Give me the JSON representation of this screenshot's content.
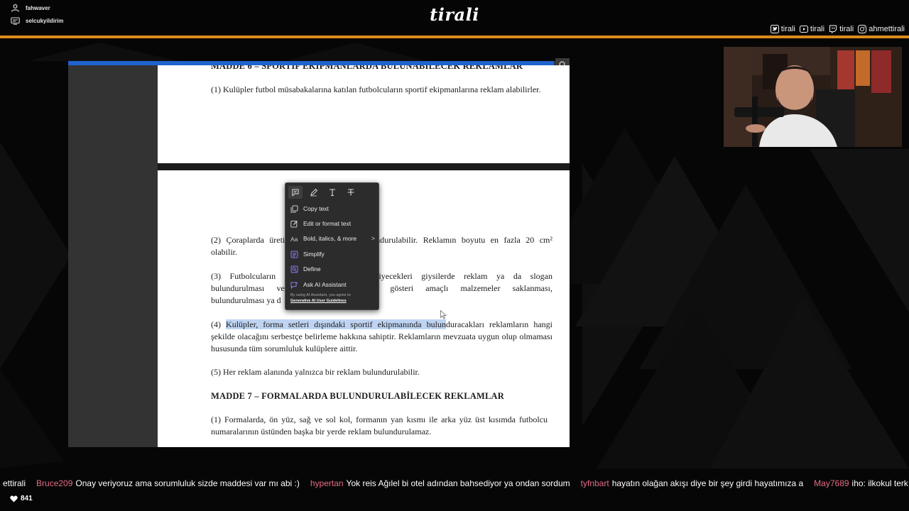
{
  "overlay": {
    "top_users": [
      {
        "icon": "user-icon",
        "name": "fahwaver"
      },
      {
        "icon": "subscriber-icon",
        "name": "selcukyildirim"
      }
    ],
    "logo": "tirali",
    "socials": [
      {
        "icon": "twitter-icon",
        "handle": "tirali"
      },
      {
        "icon": "youtube-icon",
        "handle": "tirali"
      },
      {
        "icon": "twitch-icon",
        "handle": "tirali"
      },
      {
        "icon": "instagram-icon",
        "handle": "ahmettirali"
      }
    ],
    "accent_color": "#d98c1c"
  },
  "document": {
    "page1": {
      "heading_cut": "MADDE 6 – SPORTİF EKİPMANLARDA BULUNABİLECEK REKLAMLAR",
      "para1": "(1) Kulüpler futbol müsabakalarına katılan futbolcuların sportif ekipmanlarına reklam alabilirler."
    },
    "page2": {
      "para2_a": "(2) Çoraplarda üreti",
      "para2_b": "undurulabilir. Reklamın boyutu en fazla 20 cm² olabilir.",
      "para3_a": "(3) Futbolcuların s",
      "para3_b": "giyecekleri giysilerde reklam ya da slogan bulundurulması ve",
      "para3_c": "da gösteri amaçlı malzemeler saklanması, bulundurulması ya d",
      "para4_selected": "Kulüpler, forma setleri dışındaki sportif ekipmanında bulun",
      "para4_prefix": "(4) ",
      "para4_rest": "duracakları reklamların hangi şekilde olacağını serbestçe belirleme hakkına sahiptir. Reklamların mevzuata uygun olup olmaması hususunda tüm sorumluluk kulüplere aittir.",
      "para5": "(5) Her reklam alanında yalnızca bir reklam bulundurulabilir.",
      "heading7": "MADDE 7 – FORMALARDA BULUNDURULABİLECEK REKLAMLAR",
      "para7_1": "(1)  Formalarda, ön yüz, sağ ve sol kol, formanın yan kısmı ile arka yüz üst kısımda futbolcu numaralarının üstünden başka bir yerde reklam bulundurulamaz."
    },
    "selection_color": "#bfd4f2",
    "toolbar_color": "#1f63cf"
  },
  "context_menu": {
    "tools": [
      "highlight-comment-icon",
      "draw-icon",
      "text-icon",
      "strikethrough-icon"
    ],
    "items": [
      {
        "icon": "copy-icon",
        "label": "Copy text"
      },
      {
        "icon": "edit-icon",
        "label": "Edit or format text"
      },
      {
        "icon": "font-icon",
        "label": "Bold, italics, & more",
        "submenu": ">"
      },
      {
        "icon": "simplify-icon",
        "label": "Simplify"
      },
      {
        "icon": "define-icon",
        "label": "Define"
      },
      {
        "icon": "ai-assistant-icon",
        "label": "Ask AI Assistant"
      }
    ],
    "ai_note": "By using AI Assistant, you agree to",
    "ai_link": "Generative AI User Guidelines"
  },
  "chat": {
    "messages": [
      {
        "user": "",
        "text": "ettirali"
      },
      {
        "user": "Bruce209",
        "text": "Onay veriyoruz ama sorumluluk sizde maddesi var mı abi :)"
      },
      {
        "user": "hypertan",
        "text": "Yok reis Ağılel bi otel adından bahsediyor ya ondan sordum"
      },
      {
        "user": "tyfnbart",
        "text": "hayatın olağan akışı diye bir şey girdi hayatımıza a"
      },
      {
        "user": "May7689",
        "text": "iho: ilkokul terk"
      }
    ],
    "likes": "841",
    "username_color": "#e56a85"
  }
}
